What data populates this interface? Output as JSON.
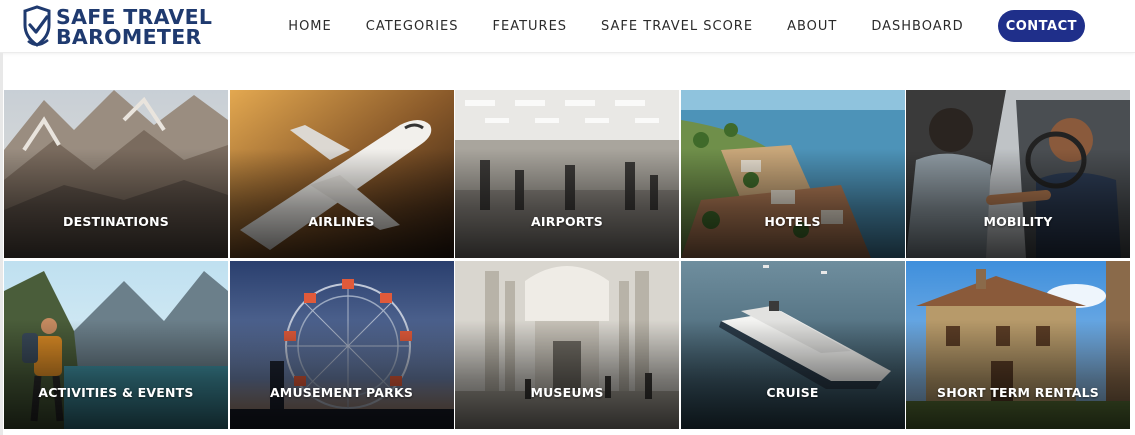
{
  "brand": {
    "line1": "SAFE TRAVEL",
    "line2": "BAROMETER",
    "color": "#1f3a6f"
  },
  "nav": {
    "items": [
      "HOME",
      "CATEGORIES",
      "FEATURES",
      "SAFE TRAVEL SCORE",
      "ABOUT",
      "DASHBOARD"
    ],
    "contact": "CONTACT",
    "contact_color": "#1f2f8a"
  },
  "categories": [
    {
      "label": "DESTINATIONS",
      "image": "mountain-valley"
    },
    {
      "label": "AIRLINES",
      "image": "airplane"
    },
    {
      "label": "AIRPORTS",
      "image": "airport-terminal"
    },
    {
      "label": "HOTELS",
      "image": "coastal-resort"
    },
    {
      "label": "MOBILITY",
      "image": "car-handshake"
    },
    {
      "label": "ACTIVITIES & EVENTS",
      "image": "hiker-lake"
    },
    {
      "label": "AMUSEMENT PARKS",
      "image": "ferris-wheel"
    },
    {
      "label": "MUSEUMS",
      "image": "museum-hall"
    },
    {
      "label": "CRUISE",
      "image": "cruise-ship"
    },
    {
      "label": "SHORT TERM RENTALS",
      "image": "stone-house"
    }
  ]
}
